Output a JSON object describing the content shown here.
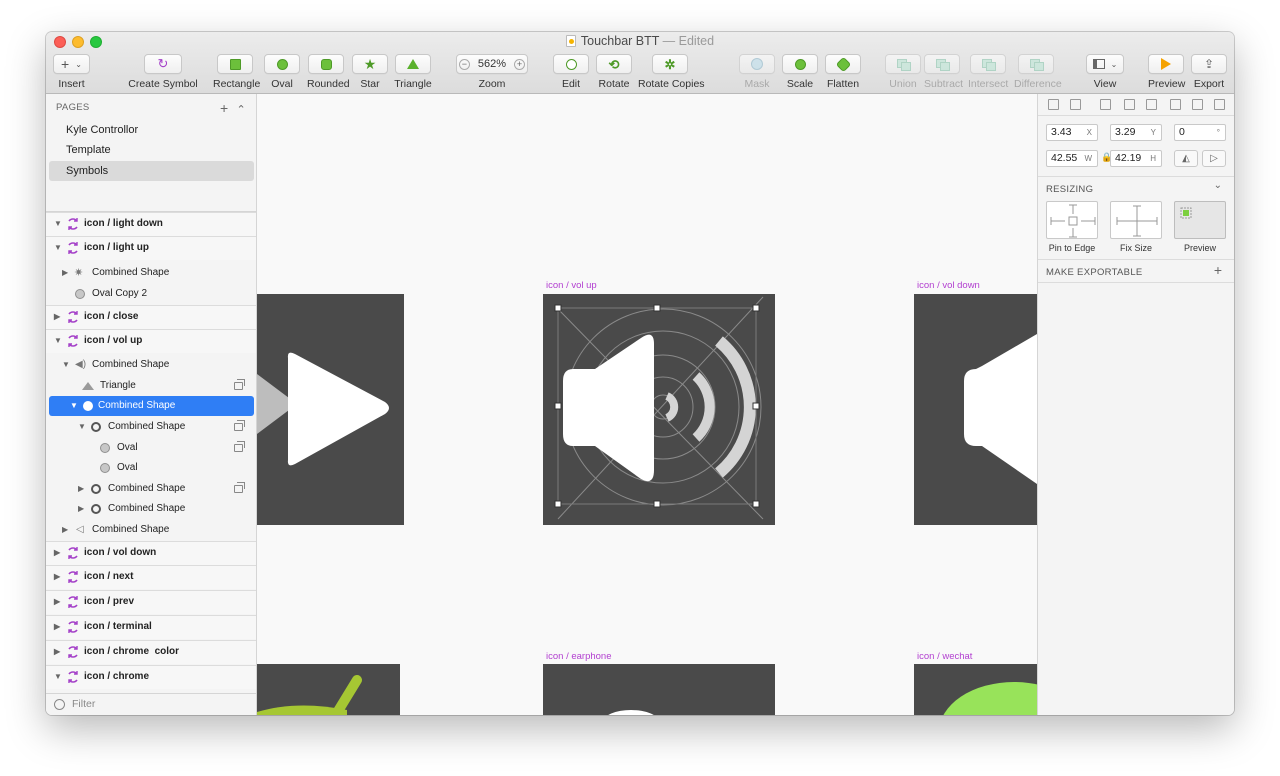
{
  "window": {
    "title": "Touchbar BTT",
    "edited": "— Edited"
  },
  "toolbar": {
    "insert": "Insert",
    "create_symbol": "Create Symbol",
    "rectangle": "Rectangle",
    "oval": "Oval",
    "rounded": "Rounded",
    "star": "Star",
    "triangle": "Triangle",
    "zoom_label": "Zoom",
    "zoom_value": "562%",
    "edit": "Edit",
    "rotate": "Rotate",
    "rotate_copies": "Rotate Copies",
    "mask": "Mask",
    "scale": "Scale",
    "flatten": "Flatten",
    "union": "Union",
    "subtract": "Subtract",
    "intersect": "Intersect",
    "difference": "Difference",
    "view": "View",
    "preview": "Preview",
    "export": "Export"
  },
  "pages": {
    "header": "PAGES",
    "items": [
      "Kyle Controllor",
      "Template",
      "Symbols"
    ]
  },
  "layers": [
    "icon / light down",
    "icon / light up",
    "Combined Shape",
    "Oval Copy 2",
    "icon / close",
    "icon / vol up",
    "Combined Shape",
    "Triangle",
    "Combined Shape",
    "Combined Shape",
    "Oval",
    "Oval",
    "Combined Shape",
    "Combined Shape",
    "Combined Shape",
    "icon / vol down",
    "icon / next",
    "icon / prev",
    "icon / terminal",
    "icon / chrome  color",
    "icon / chrome"
  ],
  "filter": {
    "placeholder": "Filter"
  },
  "canvas": {
    "labels": [
      "icon / vol up",
      "icon / vol down",
      "icon / earphone",
      "icon / wechat"
    ]
  },
  "inspector": {
    "x": "3.43",
    "x_suffix": "X",
    "y": "3.29",
    "y_suffix": "Y",
    "rotation": "0",
    "rotation_suffix": "°",
    "w": "42.55",
    "w_suffix": "W",
    "h": "42.19",
    "h_suffix": "H",
    "resizing": "RESIZING",
    "pin_to_edge": "Pin to Edge",
    "fix_size": "Fix Size",
    "preview": "Preview",
    "make_exportable": "MAKE EXPORTABLE"
  },
  "colors": {
    "artboard_label": "#b23fd0",
    "selection": "#2f7ef5",
    "tool_green": "#6cc03b",
    "artboard_bg": "#4a4a4a"
  }
}
